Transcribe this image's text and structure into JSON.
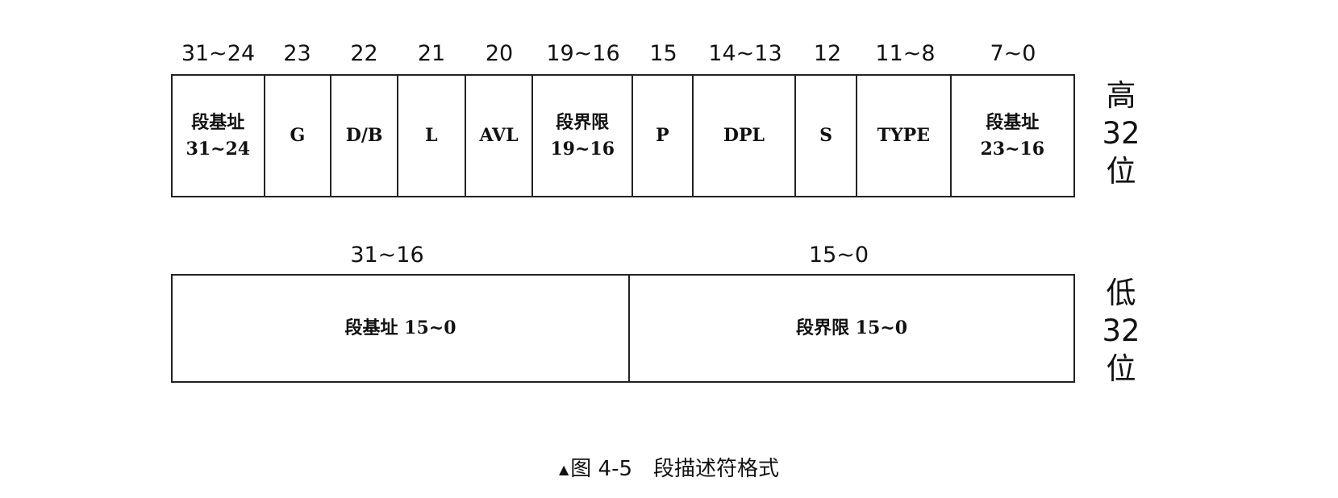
{
  "high": {
    "bits": [
      "31~24",
      "23",
      "22",
      "21",
      "20",
      "19~16",
      "15",
      "14~13",
      "12",
      "11~8",
      "7~0"
    ],
    "fields": [
      [
        "段基址",
        "31~24"
      ],
      [
        "G"
      ],
      [
        "D/B"
      ],
      [
        "L"
      ],
      [
        "AVL"
      ],
      [
        "段界限",
        "19~16"
      ],
      [
        "P"
      ],
      [
        "DPL"
      ],
      [
        "S"
      ],
      [
        "TYPE"
      ],
      [
        "段基址",
        "23~16"
      ]
    ],
    "side_label": [
      "高",
      "32",
      "位"
    ]
  },
  "low": {
    "bits": [
      "31~16",
      "15~0"
    ],
    "fields": [
      "段基址 15~0",
      "段界限 15~0"
    ],
    "side_label": [
      "低",
      "32",
      "位"
    ]
  },
  "caption": {
    "marker": "▲",
    "text": "图 4-5　段描述符格式"
  }
}
